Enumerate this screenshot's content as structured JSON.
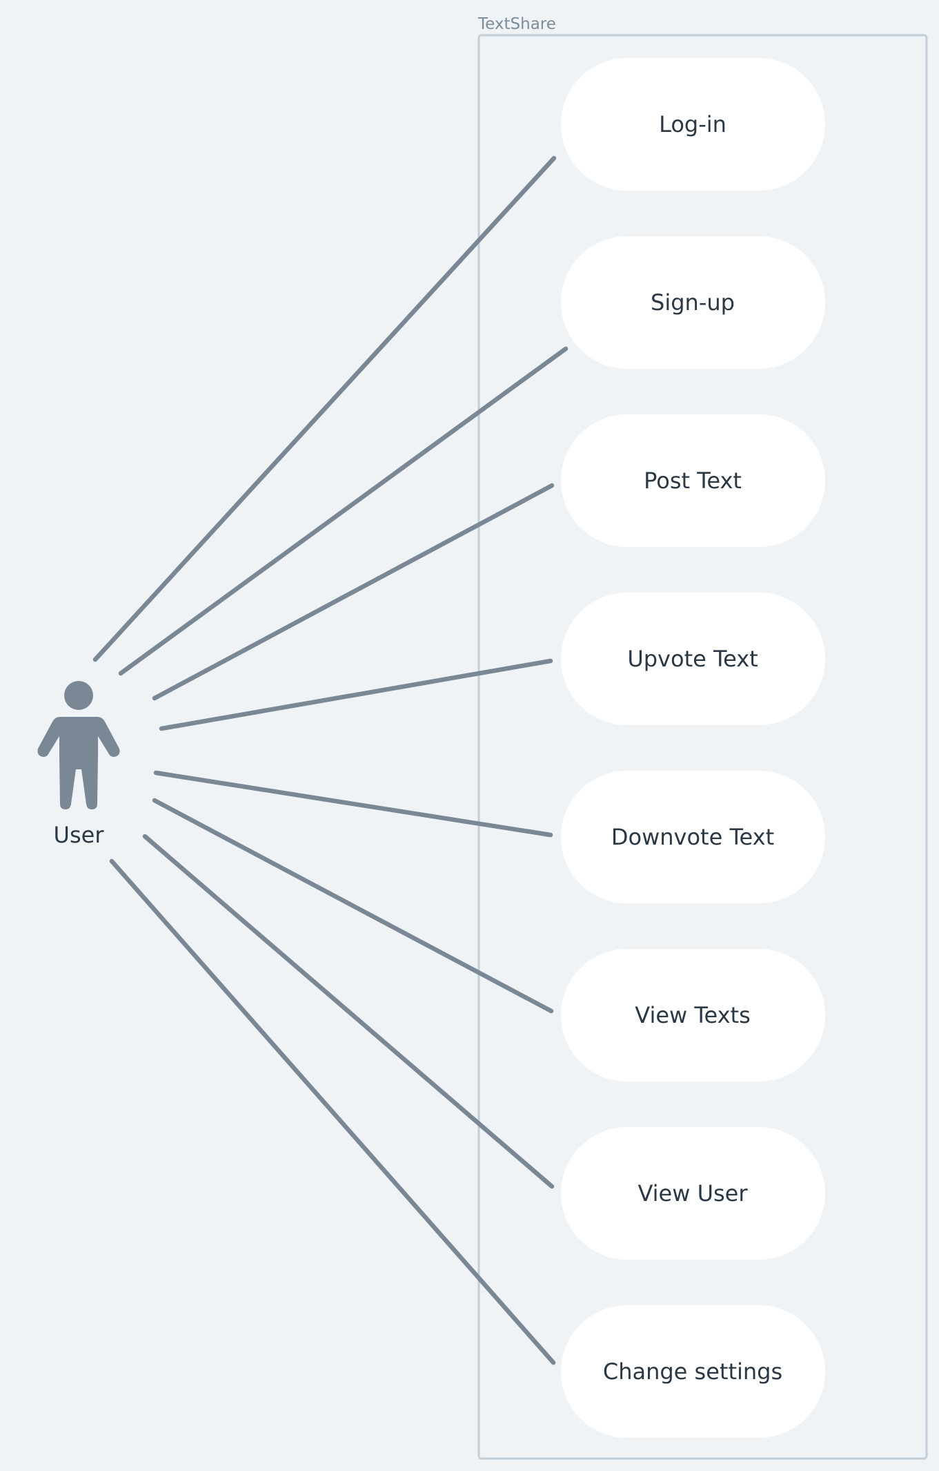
{
  "system": {
    "name": "TextShare"
  },
  "actor": {
    "label": "User",
    "icon": "person-icon"
  },
  "use_cases": [
    {
      "label": "Log-in"
    },
    {
      "label": "Sign-up"
    },
    {
      "label": "Post Text"
    },
    {
      "label": "Upvote Text"
    },
    {
      "label": "Downvote Text"
    },
    {
      "label": "View Texts"
    },
    {
      "label": "View User"
    },
    {
      "label": "Change settings"
    }
  ],
  "associations": [
    {
      "from": "User",
      "to": "Log-in"
    },
    {
      "from": "User",
      "to": "Sign-up"
    },
    {
      "from": "User",
      "to": "Post Text"
    },
    {
      "from": "User",
      "to": "Upvote Text"
    },
    {
      "from": "User",
      "to": "Downvote Text"
    },
    {
      "from": "User",
      "to": "View Texts"
    },
    {
      "from": "User",
      "to": "View User"
    },
    {
      "from": "User",
      "to": "Change settings"
    }
  ],
  "colors": {
    "background": "#eff3f6",
    "boundary": "#c2ced8",
    "connector": "#7a8896",
    "usecase_fill": "#ffffff",
    "text": "#2a3745"
  }
}
